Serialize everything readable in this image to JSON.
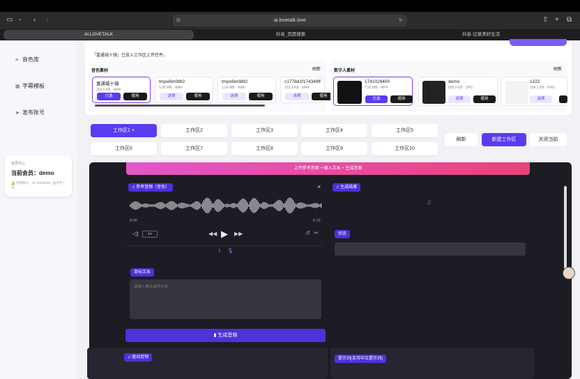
{
  "browser": {
    "url": "ai.lovetalk.love",
    "tabs": [
      "AI.LOVETALK",
      "抖音_百度搜索",
      "抖音-记录美好生活"
    ]
  },
  "sidebar": {
    "items": [
      {
        "icon": "list-icon",
        "label": "音色库"
      },
      {
        "icon": "grid-icon",
        "label": "字幕模板"
      },
      {
        "icon": "send-icon",
        "label": "发布账号"
      }
    ],
    "member": {
      "section": "会员中心",
      "current": "当前会员：demo",
      "points": "🔔 可用积分：76.76830045 · 益付不 ( 当"
    }
  },
  "notice": "「富通城十镜」已放入工作区上传控件。",
  "voice_section": {
    "title": "音色素材",
    "refresh": "刷新",
    "items": [
      {
        "name": "富通城十镜",
        "meta": "203.0 KB · M4A",
        "btn1": "已选",
        "btn2": "使用"
      },
      {
        "name": "tmpx6im98t2",
        "meta": "1.06 MB · WAV",
        "btn1": "选择",
        "btn2": "使用"
      },
      {
        "name": "tmpx6im98t2",
        "meta": "1.06 MB · WAV",
        "btn1": "选择",
        "btn2": "使用"
      },
      {
        "name": "c1778d1f174348ff",
        "meta": "203.0 KB · M4A",
        "btn1": "选择",
        "btn2": "使用"
      }
    ]
  },
  "human_section": {
    "title": "数字人素材",
    "refresh": "刷新",
    "items": [
      {
        "name": "1741029400",
        "meta": "7.92 MB · MP4",
        "btn1": "已选",
        "btn2": "使用"
      },
      {
        "name": "demo",
        "meta": "855.9 KB · JPG",
        "btn1": "选择",
        "btn2": "使用"
      },
      {
        "name": "1222",
        "meta": "164.1 KB · PNG",
        "btn1": "选择",
        "btn2": ""
      }
    ]
  },
  "workspaces": {
    "row1": [
      "工作区1 ×",
      "工作区2",
      "工作区3",
      "工作区4",
      "工作区5"
    ],
    "row2": [
      "工作区6",
      "工作区7",
      "工作区8",
      "工作区9",
      "工作区10"
    ],
    "refresh": "刷新",
    "new": "新建工作区",
    "close": "关闭当前"
  },
  "editor": {
    "banner": "上传参考音频 + 输入文本 + 生成音频",
    "ref_audio_label": "♫ 参考音频（音色）",
    "result_label": "♫ 生成结果",
    "time_start": "0:00",
    "time_end": "0:12",
    "speed": "1x",
    "status_label": "状态",
    "target_label": "目标文本",
    "target_placeholder": "请输入要合成的文本",
    "generate": "生成音频",
    "drive_label": "♫ 驱动音频",
    "prompt_label": "提示词(支持中文提示词)"
  }
}
